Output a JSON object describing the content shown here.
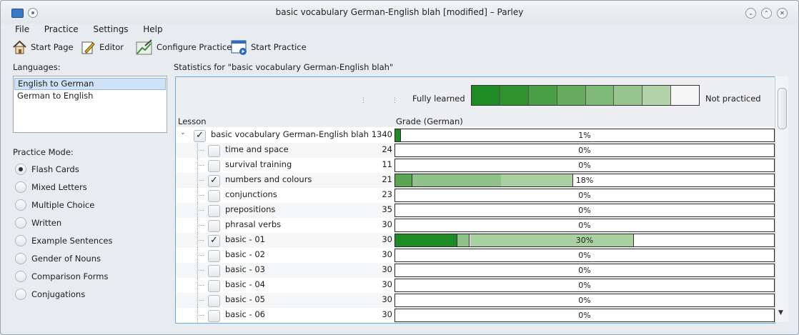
{
  "window": {
    "title": "basic vocabulary German-English blah [modified] – Parley"
  },
  "menu": [
    "File",
    "Practice",
    "Settings",
    "Help"
  ],
  "toolbar": {
    "start_page": "Start Page",
    "editor": "Editor",
    "configure_practice": "Configure Practice",
    "start_practice": "Start Practice"
  },
  "languages": {
    "label": "Languages:",
    "items": [
      "English to German",
      "German to English"
    ],
    "selected": "English to German"
  },
  "practice_mode": {
    "label": "Practice Mode:",
    "options": [
      "Flash Cards",
      "Mixed Letters",
      "Multiple Choice",
      "Written",
      "Example Sentences",
      "Gender of Nouns",
      "Comparison Forms",
      "Conjugations"
    ],
    "selected": "Flash Cards"
  },
  "stats": {
    "title": "Statistics for \"basic vocabulary German-English blah\"",
    "legend_left": "Fully learned",
    "legend_right": "Not practiced",
    "legend_colors": [
      "#1e8a23",
      "#2f922f",
      "#4a9e45",
      "#66ac5f",
      "#7db877",
      "#97c590",
      "#b2d2aa",
      "#f5f5f5"
    ],
    "col_lesson": "Lesson",
    "col_grade": "Grade (German)"
  },
  "lessons": [
    {
      "name": "basic vocabulary German-English blah",
      "count": "1340",
      "checked": true,
      "root": true,
      "pct": "1%",
      "fills": [
        {
          "from": 0.0,
          "to": 0.015,
          "color": "#1e8a23"
        }
      ]
    },
    {
      "name": "time and space",
      "count": "24",
      "checked": false,
      "pct": "0%",
      "fills": []
    },
    {
      "name": "survival training",
      "count": "11",
      "checked": false,
      "pct": "0%",
      "fills": []
    },
    {
      "name": "numbers and colours",
      "count": "21",
      "checked": true,
      "pct": "18%",
      "fills": [
        {
          "from": 0.0,
          "to": 0.045,
          "color": "#5aa553"
        },
        {
          "from": 0.045,
          "to": 0.28,
          "color": "#8fc288"
        },
        {
          "from": 0.28,
          "to": 0.47,
          "color": "#a9d0a1"
        }
      ]
    },
    {
      "name": "conjunctions",
      "count": "23",
      "checked": false,
      "pct": "0%",
      "fills": []
    },
    {
      "name": "prepositions",
      "count": "35",
      "checked": false,
      "pct": "0%",
      "fills": []
    },
    {
      "name": "phrasal verbs",
      "count": "30",
      "checked": false,
      "pct": "0%",
      "fills": []
    },
    {
      "name": "basic - 01",
      "count": "30",
      "checked": true,
      "pct": "30%",
      "fills": [
        {
          "from": 0.0,
          "to": 0.165,
          "color": "#1e8a23"
        },
        {
          "from": 0.165,
          "to": 0.198,
          "color": "#8fc288"
        },
        {
          "from": 0.198,
          "to": 0.63,
          "color": "#a9d0a1"
        }
      ]
    },
    {
      "name": "basic - 02",
      "count": "30",
      "checked": false,
      "pct": "0%",
      "fills": []
    },
    {
      "name": "basic - 03",
      "count": "30",
      "checked": false,
      "pct": "0%",
      "fills": []
    },
    {
      "name": "basic - 04",
      "count": "30",
      "checked": false,
      "pct": "0%",
      "fills": []
    },
    {
      "name": "basic - 05",
      "count": "30",
      "checked": false,
      "pct": "0%",
      "fills": []
    },
    {
      "name": "basic - 06",
      "count": "30",
      "checked": false,
      "pct": "0%",
      "fills": []
    }
  ]
}
